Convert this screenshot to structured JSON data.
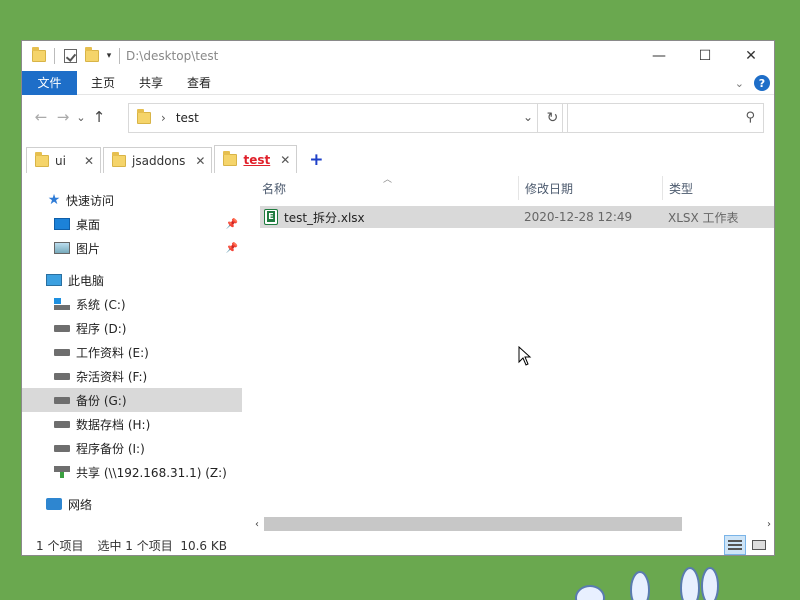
{
  "window": {
    "title_path": "D:\\desktop\\test",
    "controls": {
      "minimize": "—",
      "maximize": "☐",
      "close": "✕"
    }
  },
  "ribbon": {
    "tabs": [
      "文件",
      "主页",
      "共享",
      "查看"
    ]
  },
  "navigation": {
    "back": "←",
    "forward": "→",
    "recent": "⌄",
    "up": "↑",
    "breadcrumb_separator": "›",
    "address": "test",
    "search_placeholder": ""
  },
  "tabs": [
    {
      "label": "ui",
      "active": false
    },
    {
      "label": "jsaddons",
      "active": false
    },
    {
      "label": "test",
      "active": true
    }
  ],
  "tab_add": "+",
  "sidebar": {
    "quick_access": "快速访问",
    "pinned": [
      {
        "label": "桌面",
        "icon": "desktop-icon"
      },
      {
        "label": "图片",
        "icon": "pictures-icon"
      }
    ],
    "this_pc": "此电脑",
    "drives": [
      {
        "label": "系统 (C:)",
        "icon": "system-drive-icon"
      },
      {
        "label": "程序 (D:)",
        "icon": "drive-icon"
      },
      {
        "label": "工作资料 (E:)",
        "icon": "drive-icon"
      },
      {
        "label": "杂活资料 (F:)",
        "icon": "drive-icon"
      },
      {
        "label": "备份 (G:)",
        "icon": "drive-icon",
        "selected": true
      },
      {
        "label": "数据存档 (H:)",
        "icon": "drive-icon"
      },
      {
        "label": "程序备份 (I:)",
        "icon": "drive-icon"
      },
      {
        "label": "共享 (\\\\192.168.31.1) (Z:)",
        "icon": "network-drive-icon"
      }
    ],
    "network": "网络"
  },
  "file_list": {
    "columns": [
      "名称",
      "修改日期",
      "类型"
    ],
    "rows": [
      {
        "name": "test_拆分.xlsx",
        "modified": "2020-12-28 12:49",
        "type": "XLSX 工作表"
      }
    ]
  },
  "status": {
    "item_count": "1 个项目",
    "selection": "选中 1 个项目  10.6 KB"
  },
  "colors": {
    "accent": "#1e6ec8",
    "active_tab_text": "#e0202a",
    "selection": "#d9d9d9",
    "desktop": "#6aa84f"
  }
}
